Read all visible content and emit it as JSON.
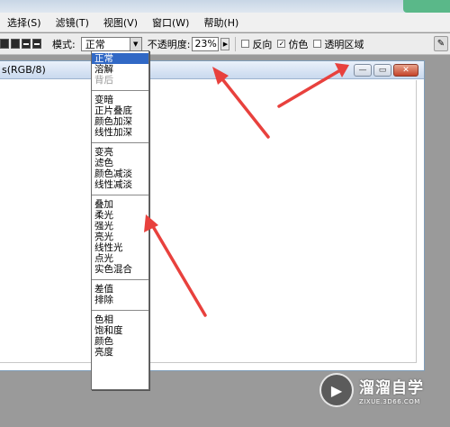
{
  "menubar": {
    "items": [
      "选择(S)",
      "滤镜(T)",
      "视图(V)",
      "窗口(W)",
      "帮助(H)"
    ]
  },
  "options": {
    "mode_label": "模式:",
    "mode_value": "正常",
    "opacity_label": "不透明度:",
    "opacity_value": "23%",
    "reverse_label": "反向",
    "reverse_checked": false,
    "dither_label": "仿色",
    "dither_checked": true,
    "transparency_label": "透明区域",
    "transparency_checked": false
  },
  "document": {
    "title": "s(RGB/8)"
  },
  "blend_modes": {
    "groups": [
      [
        "正常",
        "溶解",
        "背后"
      ],
      [
        "变暗",
        "正片叠底",
        "颜色加深",
        "线性加深"
      ],
      [
        "变亮",
        "滤色",
        "颜色减淡",
        "线性减淡"
      ],
      [
        "叠加",
        "柔光",
        "强光",
        "亮光",
        "线性光",
        "点光",
        "实色混合"
      ],
      [
        "差值",
        "排除"
      ],
      [
        "色相",
        "饱和度",
        "颜色",
        "亮度"
      ]
    ],
    "selected": "正常",
    "disabled": [
      "背后"
    ]
  },
  "watermark": {
    "title": "溜溜自学",
    "url": "ZIXUE.3D66.COM"
  },
  "colors": {
    "selection": "#3168c5",
    "arrow": "#e8413d",
    "desktop": "#9a9a9a"
  }
}
